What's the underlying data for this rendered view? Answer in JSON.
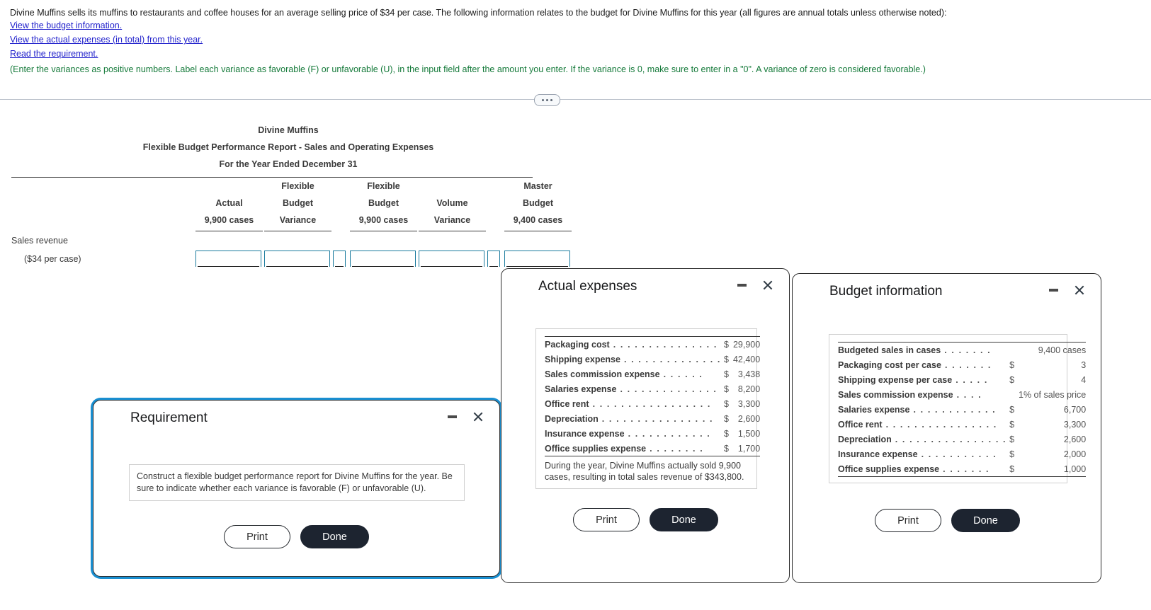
{
  "problem": {
    "intro": "Divine Muffins sells its muffins to restaurants and coffee houses for an average selling price of $34 per case. The following information relates to the budget for Divine Muffins for this year (all figures are annual totals unless otherwise noted):",
    "links": [
      "View the budget information.",
      "View the actual expenses (in total) from this year.",
      "Read the requirement."
    ],
    "note": "(Enter the variances as positive numbers. Label each variance as favorable (F) or unfavorable (U), in the input field after the amount you enter. If the variance is 0, make sure to enter in a \"0\". A variance of zero is considered favorable.)"
  },
  "worksheet": {
    "title_lines": [
      "Divine Muffins",
      "Flexible Budget Performance Report - Sales and Operating Expenses",
      "For the Year Ended December 31"
    ],
    "columns": [
      {
        "line1": "",
        "line2": "Actual",
        "line3": "9,900 cases"
      },
      {
        "line1": "Flexible",
        "line2": "Budget",
        "line3": "Variance"
      },
      {
        "line1": "Flexible",
        "line2": "Budget",
        "line3": "9,900 cases"
      },
      {
        "line1": "",
        "line2": "Volume",
        "line3": "Variance"
      },
      {
        "line1": "Master",
        "line2": "Budget",
        "line3": "9,400 cases"
      }
    ],
    "rows": [
      {
        "label": "Sales revenue",
        "sublabel": "($34 per case)",
        "values": [
          "",
          "",
          "",
          "",
          ""
        ],
        "flags": [
          "",
          ""
        ]
      }
    ]
  },
  "dialogs": {
    "requirement": {
      "title": "Requirement",
      "body": "Construct a flexible budget performance report for Divine Muffins for the year. Be sure to indicate whether each variance is favorable (F) or unfavorable (U).",
      "print_label": "Print",
      "done_label": "Done",
      "minimize_icon": "minimize-icon",
      "close_icon": "close-icon"
    },
    "actual_expenses": {
      "title": "Actual expenses",
      "rows": [
        {
          "label": "Packaging cost",
          "leader": ". . . . . . . . . . . . . . .",
          "currency": "$",
          "value": "29,900"
        },
        {
          "label": "Shipping expense",
          "leader": ". . . . . . . . . . . . . .",
          "currency": "$",
          "value": "42,400"
        },
        {
          "label": "Sales commission expense",
          "leader": ". . . . . .",
          "currency": "$",
          "value": "3,438"
        },
        {
          "label": "Salaries expense",
          "leader": ". . . . . . . . . . . . . .",
          "currency": "$",
          "value": "8,200"
        },
        {
          "label": "Office rent",
          "leader": ". . . . . . . . . . . . . . . . .",
          "currency": "$",
          "value": "3,300"
        },
        {
          "label": "Depreciation",
          "leader": ". . . . . . . . . . . . . . . .",
          "currency": "$",
          "value": "2,600"
        },
        {
          "label": "Insurance expense",
          "leader": ". . . . . . . . . . . .",
          "currency": "$",
          "value": "1,500"
        },
        {
          "label": "Office supplies expense",
          "leader": ". . . . . . . .",
          "currency": "$",
          "value": "1,700"
        }
      ],
      "note": "During the year, Divine Muffins actually sold 9,900 cases, resulting in total sales revenue of $343,800.",
      "print_label": "Print",
      "done_label": "Done",
      "minimize_icon": "minimize-icon",
      "close_icon": "close-icon"
    },
    "budget_information": {
      "title": "Budget information",
      "rows": [
        {
          "label": "Budgeted sales in cases",
          "leader": ". . . . . . .",
          "currency": "",
          "value": "9,400 cases"
        },
        {
          "label": "Packaging cost per case",
          "leader": ". . . . . . .",
          "currency": "$",
          "value": "3"
        },
        {
          "label": "Shipping expense per case",
          "leader": ". . . . .",
          "currency": "$",
          "value": "4"
        },
        {
          "label": "Sales commission expense",
          "leader": ". . . .",
          "currency": "",
          "value": "1% of sales price"
        },
        {
          "label": "Salaries expense",
          "leader": ". . . . . . . . . . . .",
          "currency": "$",
          "value": "6,700"
        },
        {
          "label": "Office rent",
          "leader": ". . . . . . . . . . . . . . . .",
          "currency": "$",
          "value": "3,300"
        },
        {
          "label": "Depreciation",
          "leader": ". . . . . . . . . . . . . . . .",
          "currency": "$",
          "value": "2,600"
        },
        {
          "label": "Insurance expense",
          "leader": ". . . . . . . . . . .",
          "currency": "$",
          "value": "2,000"
        },
        {
          "label": "Office supplies expense",
          "leader": ". . . . . . .",
          "currency": "$",
          "value": "1,000"
        }
      ],
      "print_label": "Print",
      "done_label": "Done",
      "minimize_icon": "minimize-icon",
      "close_icon": "close-icon"
    }
  },
  "colors": {
    "link": "#2222cc",
    "note": "#157a3a",
    "input_border": "#1b7b9e",
    "primary_button": "#1d2430",
    "focus_ring": "#1a8fd1"
  }
}
